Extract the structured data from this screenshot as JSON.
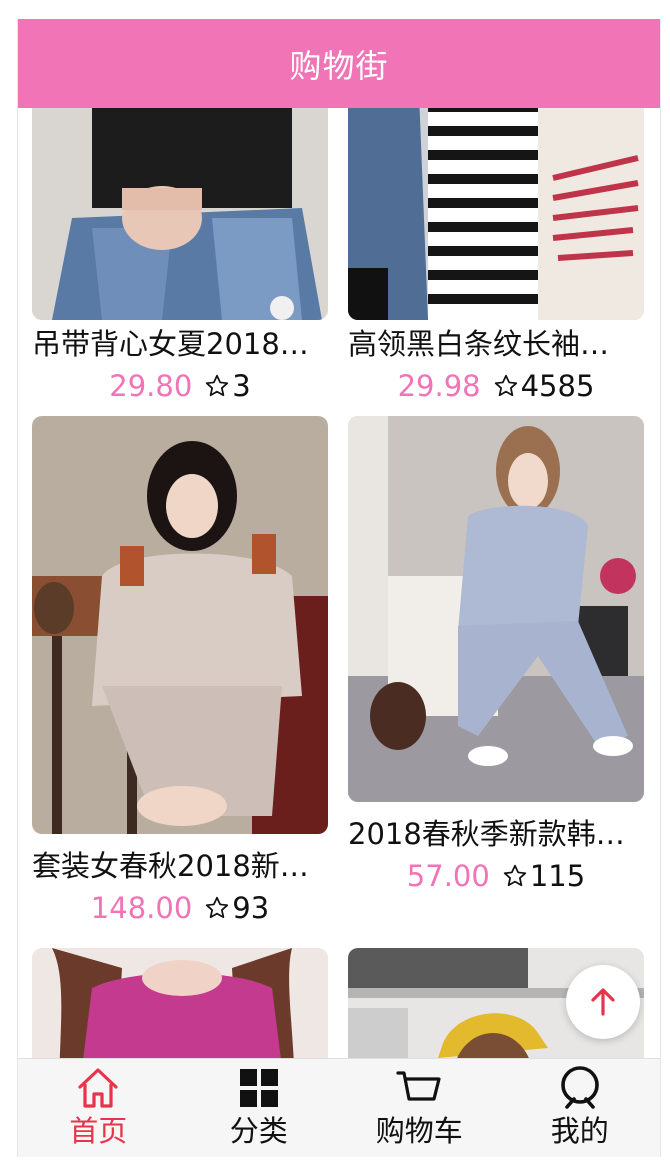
{
  "header": {
    "title": "购物街"
  },
  "products": [
    {
      "title": "吊带背心女夏2018…",
      "price": "29.80",
      "cfav": "3"
    },
    {
      "title": "高领黑白条纹长袖…",
      "price": "29.98",
      "cfav": "4585"
    },
    {
      "title": "套装女春秋2018新…",
      "price": "148.00",
      "cfav": "93"
    },
    {
      "title": "2018春秋季新款韩…",
      "price": "57.00",
      "cfav": "115"
    }
  ],
  "tabbar": {
    "items": [
      {
        "label": "首页",
        "icon": "home-icon"
      },
      {
        "label": "分类",
        "icon": "category-grid-icon"
      },
      {
        "label": "购物车",
        "icon": "shopping-cart-icon"
      },
      {
        "label": "我的",
        "icon": "profile-icon"
      }
    ]
  },
  "colors": {
    "brand_pink": "#f074b6",
    "active_tab": "#e8334a",
    "back_top_arrow": "#e8334a"
  }
}
